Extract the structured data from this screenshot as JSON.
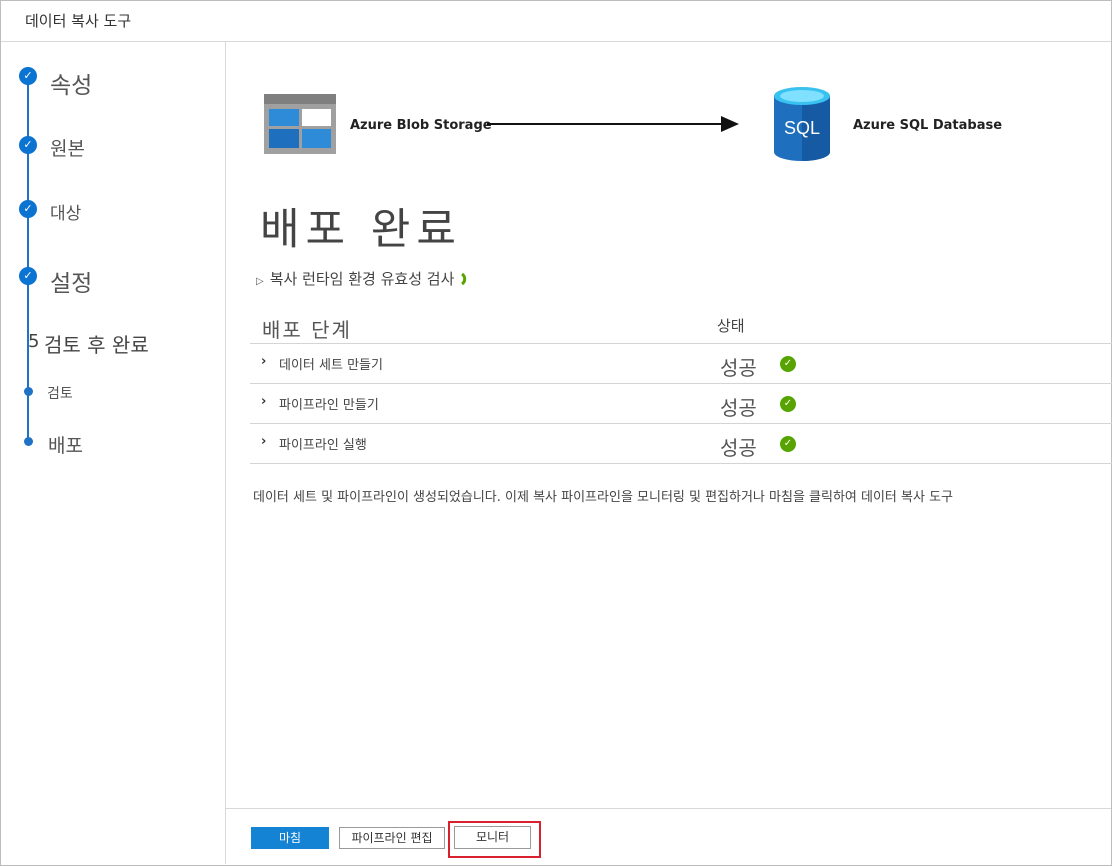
{
  "window": {
    "title": "데이터 복사 도구"
  },
  "steps": [
    {
      "label": "속성",
      "state": "done"
    },
    {
      "label": "원본",
      "state": "done"
    },
    {
      "label": "대상",
      "state": "done"
    },
    {
      "label": "설정",
      "state": "done"
    },
    {
      "number": "5",
      "label": "검토 후 완료",
      "state": "current"
    },
    {
      "label": "검토",
      "state": "substep"
    },
    {
      "label": "배포",
      "state": "substep"
    }
  ],
  "pipeline": {
    "source": "Azure Blob Storage",
    "destination": "Azure SQL Database",
    "sql_text": "SQL"
  },
  "main": {
    "headline": "배포 완료",
    "validation": "복사 런타임 환경 유효성 검사"
  },
  "table": {
    "header_step": "배포 단계",
    "header_status": "상태",
    "rows": [
      {
        "step": "데이터 세트 만들기",
        "status": "성공"
      },
      {
        "step": "파이프라인 만들기",
        "status": "성공"
      },
      {
        "step": "파이프라인 실행",
        "status": "성공"
      }
    ]
  },
  "info_text": "데이터 세트 및 파이프라인이 생성되었습니다. 이제 복사 파이프라인을 모니터링 및 편집하거나 마침을 클릭하여 데이터 복사 도구",
  "footer": {
    "finish": "마침",
    "edit_pipeline": "파이프라인 편집",
    "monitor": "모니터"
  },
  "colors": {
    "accent": "#1483d4",
    "success": "#57a300",
    "highlight": "#d8202f"
  }
}
